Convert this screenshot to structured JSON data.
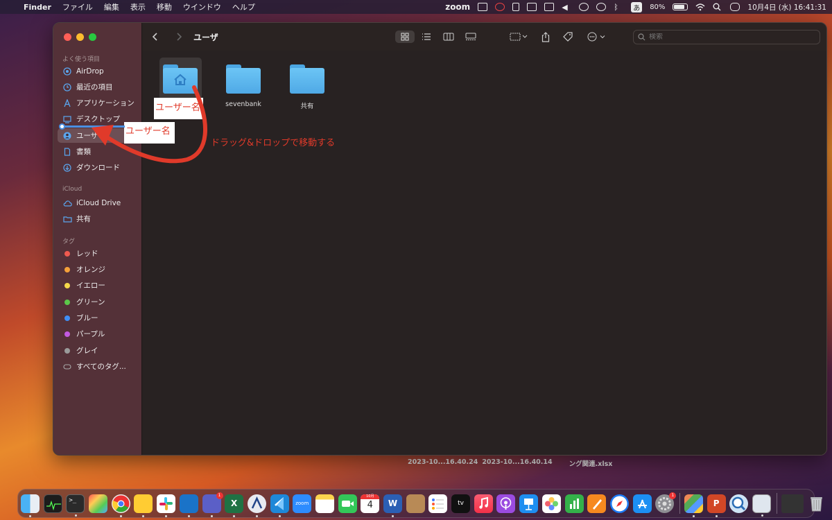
{
  "menubar": {
    "app_name": "Finder",
    "items": [
      "ファイル",
      "編集",
      "表示",
      "移動",
      "ウインドウ",
      "ヘルプ"
    ],
    "zoom_label": "zoom",
    "input_label": "あ",
    "battery_label": "80%",
    "battery_level": 0.8,
    "datetime": "10月4日 (水) 16:41:31"
  },
  "desktop": {
    "files": [
      "2023-10...16.40.24",
      "2023-10...16.40.14",
      "ング関連.xlsx"
    ]
  },
  "window": {
    "title": "ユーザ",
    "search_placeholder": "検索",
    "sidebar": {
      "favorites_header": "よく使う項目",
      "favorites": [
        {
          "label": "AirDrop",
          "icon": "airdrop-icon"
        },
        {
          "label": "最近の項目",
          "icon": "clock-icon"
        },
        {
          "label": "アプリケーション",
          "icon": "applications-icon"
        },
        {
          "label": "デスクトップ",
          "icon": "desktop-icon"
        },
        {
          "label": "ユーザ",
          "icon": "user-icon",
          "selected": true
        },
        {
          "label": "書類",
          "icon": "document-icon"
        },
        {
          "label": "ダウンロード",
          "icon": "download-icon"
        }
      ],
      "icloud_header": "iCloud",
      "icloud": [
        {
          "label": "iCloud Drive",
          "icon": "cloud-icon"
        },
        {
          "label": "共有",
          "icon": "shared-folder-icon"
        }
      ],
      "tags_header": "タグ",
      "tags": [
        {
          "label": "レッド",
          "color": "#ef5a4f"
        },
        {
          "label": "オレンジ",
          "color": "#f5a13a"
        },
        {
          "label": "イエロー",
          "color": "#f5d84a"
        },
        {
          "label": "グリーン",
          "color": "#5cc84a"
        },
        {
          "label": "ブルー",
          "color": "#3f8ef5"
        },
        {
          "label": "パープル",
          "color": "#c35ae0"
        },
        {
          "label": "グレイ",
          "color": "#9a9a9a"
        }
      ],
      "all_tags": "すべてのタグ..."
    },
    "files": [
      {
        "name": "ユーザー名",
        "icon": "home-folder-icon"
      },
      {
        "name": "sevenbank",
        "icon": "folder-icon"
      },
      {
        "name": "共有",
        "icon": "folder-icon"
      }
    ]
  },
  "annotations": {
    "file_label": "ユーザー名",
    "drag_label": "ユーザー名",
    "instruction": "ドラッグ&ドロップで移動する"
  },
  "dock": {
    "badges": {
      "teams": "1",
      "settings": "1"
    },
    "calendar": {
      "month": "10月",
      "day": "4"
    },
    "zoom_text": "zoom",
    "tv_text": "tv"
  }
}
